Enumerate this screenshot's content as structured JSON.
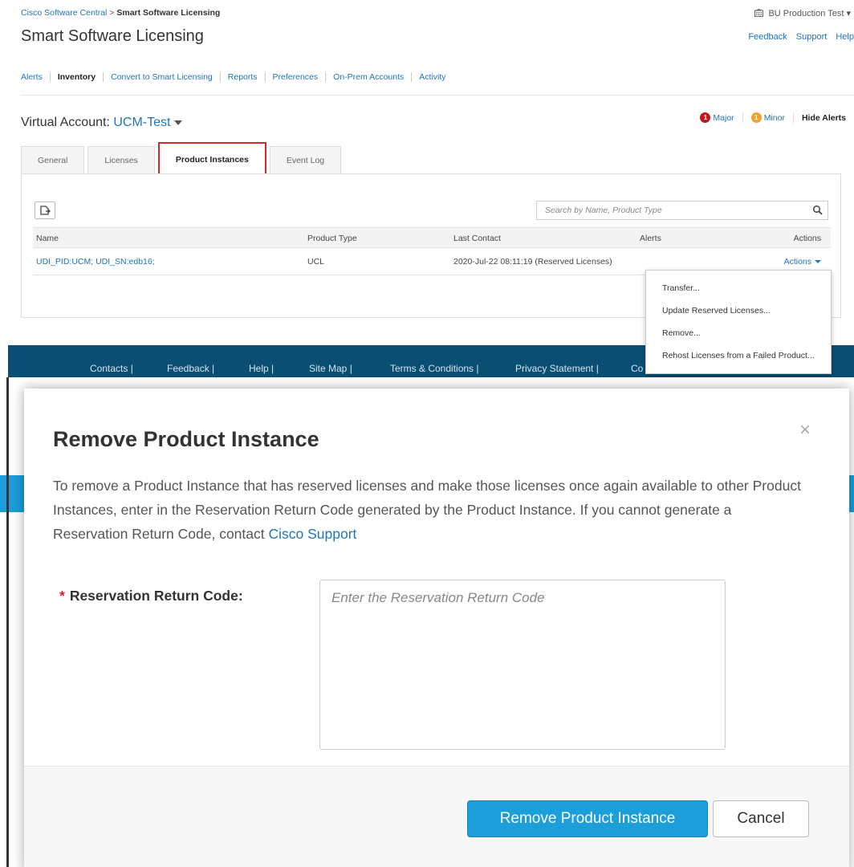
{
  "top": {
    "breadcrumb": {
      "root": "Cisco Software Central",
      "separator": ">",
      "current": "Smart Software Licensing"
    },
    "account_switcher": {
      "icon": "building-icon",
      "label": "BU Production Test",
      "caret": "▾"
    },
    "page_title": "Smart Software Licensing",
    "header_links": [
      "Feedback",
      "Support",
      "Help"
    ],
    "nav": [
      {
        "label": "Alerts",
        "active": false
      },
      {
        "label": "Inventory",
        "active": true
      },
      {
        "label": "Convert to Smart Licensing",
        "active": false
      },
      {
        "label": "Reports",
        "active": false
      },
      {
        "label": "Preferences",
        "active": false
      },
      {
        "label": "On-Prem Accounts",
        "active": false
      },
      {
        "label": "Activity",
        "active": false
      }
    ],
    "virtual_account": {
      "label": "Virtual Account:",
      "name": "UCM-Test"
    },
    "alerts": {
      "major_count": "1",
      "major_label": "Major",
      "minor_count": "1",
      "minor_label": "Minor",
      "hide_label": "Hide Alerts"
    },
    "tabs": [
      {
        "label": "General",
        "active": false
      },
      {
        "label": "Licenses",
        "active": false
      },
      {
        "label": "Product Instances",
        "active": true
      },
      {
        "label": "Event Log",
        "active": false
      }
    ],
    "search": {
      "placeholder": "Search by Name, Product Type"
    },
    "table": {
      "headers": {
        "name": "Name",
        "type": "Product Type",
        "contact": "Last Contact",
        "alerts": "Alerts",
        "actions": "Actions"
      },
      "rows": [
        {
          "name": "UDI_PID:UCM; UDI_SN:edb16;",
          "type": "UCL",
          "contact": "2020-Jul-22 08:11:19 (Reserved Licenses)",
          "alerts": "",
          "actions": "Actions"
        }
      ]
    },
    "actions_menu": [
      "Transfer...",
      "Update Reserved Licenses...",
      "Remove...",
      "Rehost Licenses from a Failed Product..."
    ],
    "footer_links": [
      "Contacts |",
      "Feedback |",
      "Help |",
      "Site Map |",
      "Terms & Conditions |",
      "Privacy Statement |",
      "Co"
    ]
  },
  "modal": {
    "title": "Remove Product Instance",
    "close_symbol": "×",
    "description": "To remove a Product Instance that has reserved licenses and make those licenses once again available to other Product Instances, enter in the Reservation Return Code generated by the Product Instance. If you cannot generate a Reservation Return Code, contact ",
    "support_link": "Cisco Support",
    "field_required_mark": "*",
    "field_label": "Reservation Return Code:",
    "field_placeholder": "Enter the Reservation Return Code",
    "field_value": "",
    "primary_button": "Remove Product Instance",
    "cancel_button": "Cancel"
  },
  "colors": {
    "link": "#2075b8",
    "primary": "#1c9ed8",
    "highlight": "#d7262e",
    "footer": "#0a4e74",
    "major": "#c4171d",
    "minor": "#f0a22a"
  }
}
